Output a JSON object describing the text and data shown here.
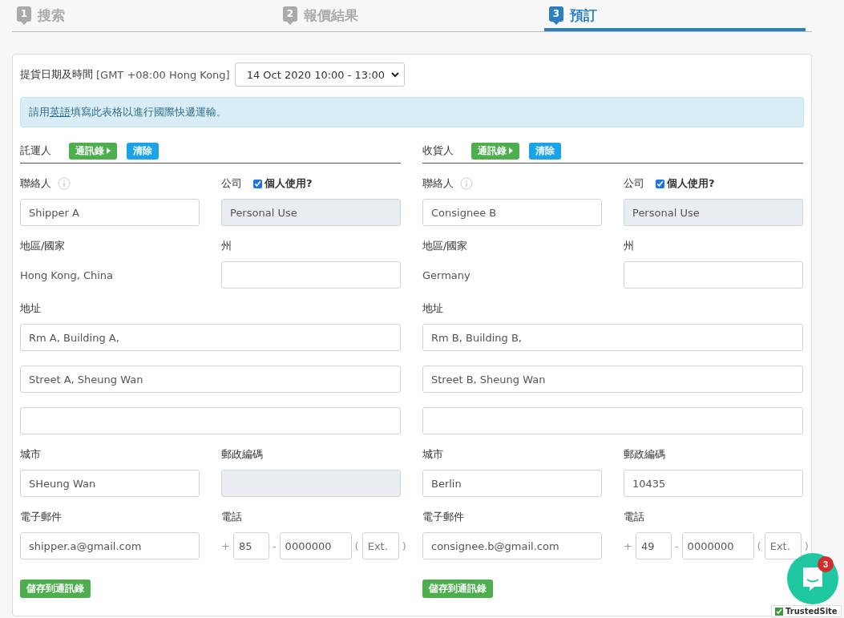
{
  "steps": [
    {
      "number": "1",
      "label": "搜索",
      "selected": false
    },
    {
      "number": "2",
      "label": "報價結果",
      "selected": false
    },
    {
      "number": "3",
      "label": "預訂",
      "selected": true
    }
  ],
  "pickup": {
    "label": "提貨日期及時間",
    "timezone": "[GMT +08:00 Hong Kong]",
    "value": "14 Oct 2020 10:00 - 13:00"
  },
  "notice": {
    "before": "請用",
    "link": "英語",
    "after": "填寫此表格以進行國際快遞運輸。"
  },
  "parties": [
    {
      "title": "託運人",
      "buttons": [
        {
          "label": "通訊錄",
          "kind": "contacts"
        },
        {
          "label": "清除",
          "kind": "clear"
        }
      ],
      "contact": {
        "label": "聯絡人",
        "value": "Shipper A"
      },
      "company": {
        "label": "公司",
        "value": "Personal Use",
        "disabled": true
      },
      "personal_use": {
        "label": "個人使用?",
        "checked": true
      },
      "country": {
        "label": "地區/國家",
        "value": "Hong Kong, China"
      },
      "state": {
        "label": "州",
        "disabled": false
      },
      "address": {
        "label": "地址",
        "lines": [
          {
            "value": "Rm A, Building A,"
          },
          {
            "value": "Street A, Sheung Wan"
          },
          {
            "disabled": false
          }
        ]
      },
      "city": {
        "label": "城市",
        "value": "SHeung Wan",
        "disabled": false
      },
      "postcode": {
        "label": "郵政編碼",
        "disabled": true
      },
      "email": {
        "label": "電子郵件",
        "value": "shipper.a@gmail.com",
        "disabled": false
      },
      "phone": {
        "label": "電話",
        "plus": "+",
        "code": "85",
        "dash": "-",
        "number": "0000000",
        "open": "(",
        "ext_placeholder": "Ext.",
        "close": ")"
      },
      "save_button": "儲存到通訊錄"
    },
    {
      "title": "收貨人",
      "buttons": [
        {
          "label": "通訊錄",
          "kind": "contacts"
        },
        {
          "label": "清除",
          "kind": "clear"
        }
      ],
      "contact": {
        "label": "聯絡人",
        "value": "Consignee B"
      },
      "company": {
        "label": "公司",
        "value": "Personal Use",
        "disabled": true
      },
      "personal_use": {
        "label": "個人使用?",
        "checked": true
      },
      "country": {
        "label": "地區/國家",
        "value": "Germany"
      },
      "state": {
        "label": "州",
        "disabled": false
      },
      "address": {
        "label": "地址",
        "lines": [
          {
            "value": "Rm B, Building B,"
          },
          {
            "value": "Street B, Sheung Wan"
          },
          {
            "disabled": false
          }
        ]
      },
      "city": {
        "label": "城市",
        "value": "Berlin",
        "disabled": false
      },
      "postcode": {
        "label": "郵政編碼",
        "value": "10435",
        "disabled": false
      },
      "email": {
        "label": "電子郵件",
        "value": "consignee.b@gmail.com",
        "disabled": false
      },
      "phone": {
        "label": "電話",
        "plus": "+",
        "code": "49",
        "dash": "-",
        "number": "0000000",
        "open": "(",
        "ext_placeholder": "Ext.",
        "close": ")"
      },
      "save_button": "儲存到通訊錄"
    }
  ],
  "chat": {
    "badge": "3"
  },
  "trust_badge": "TrustedSite"
}
